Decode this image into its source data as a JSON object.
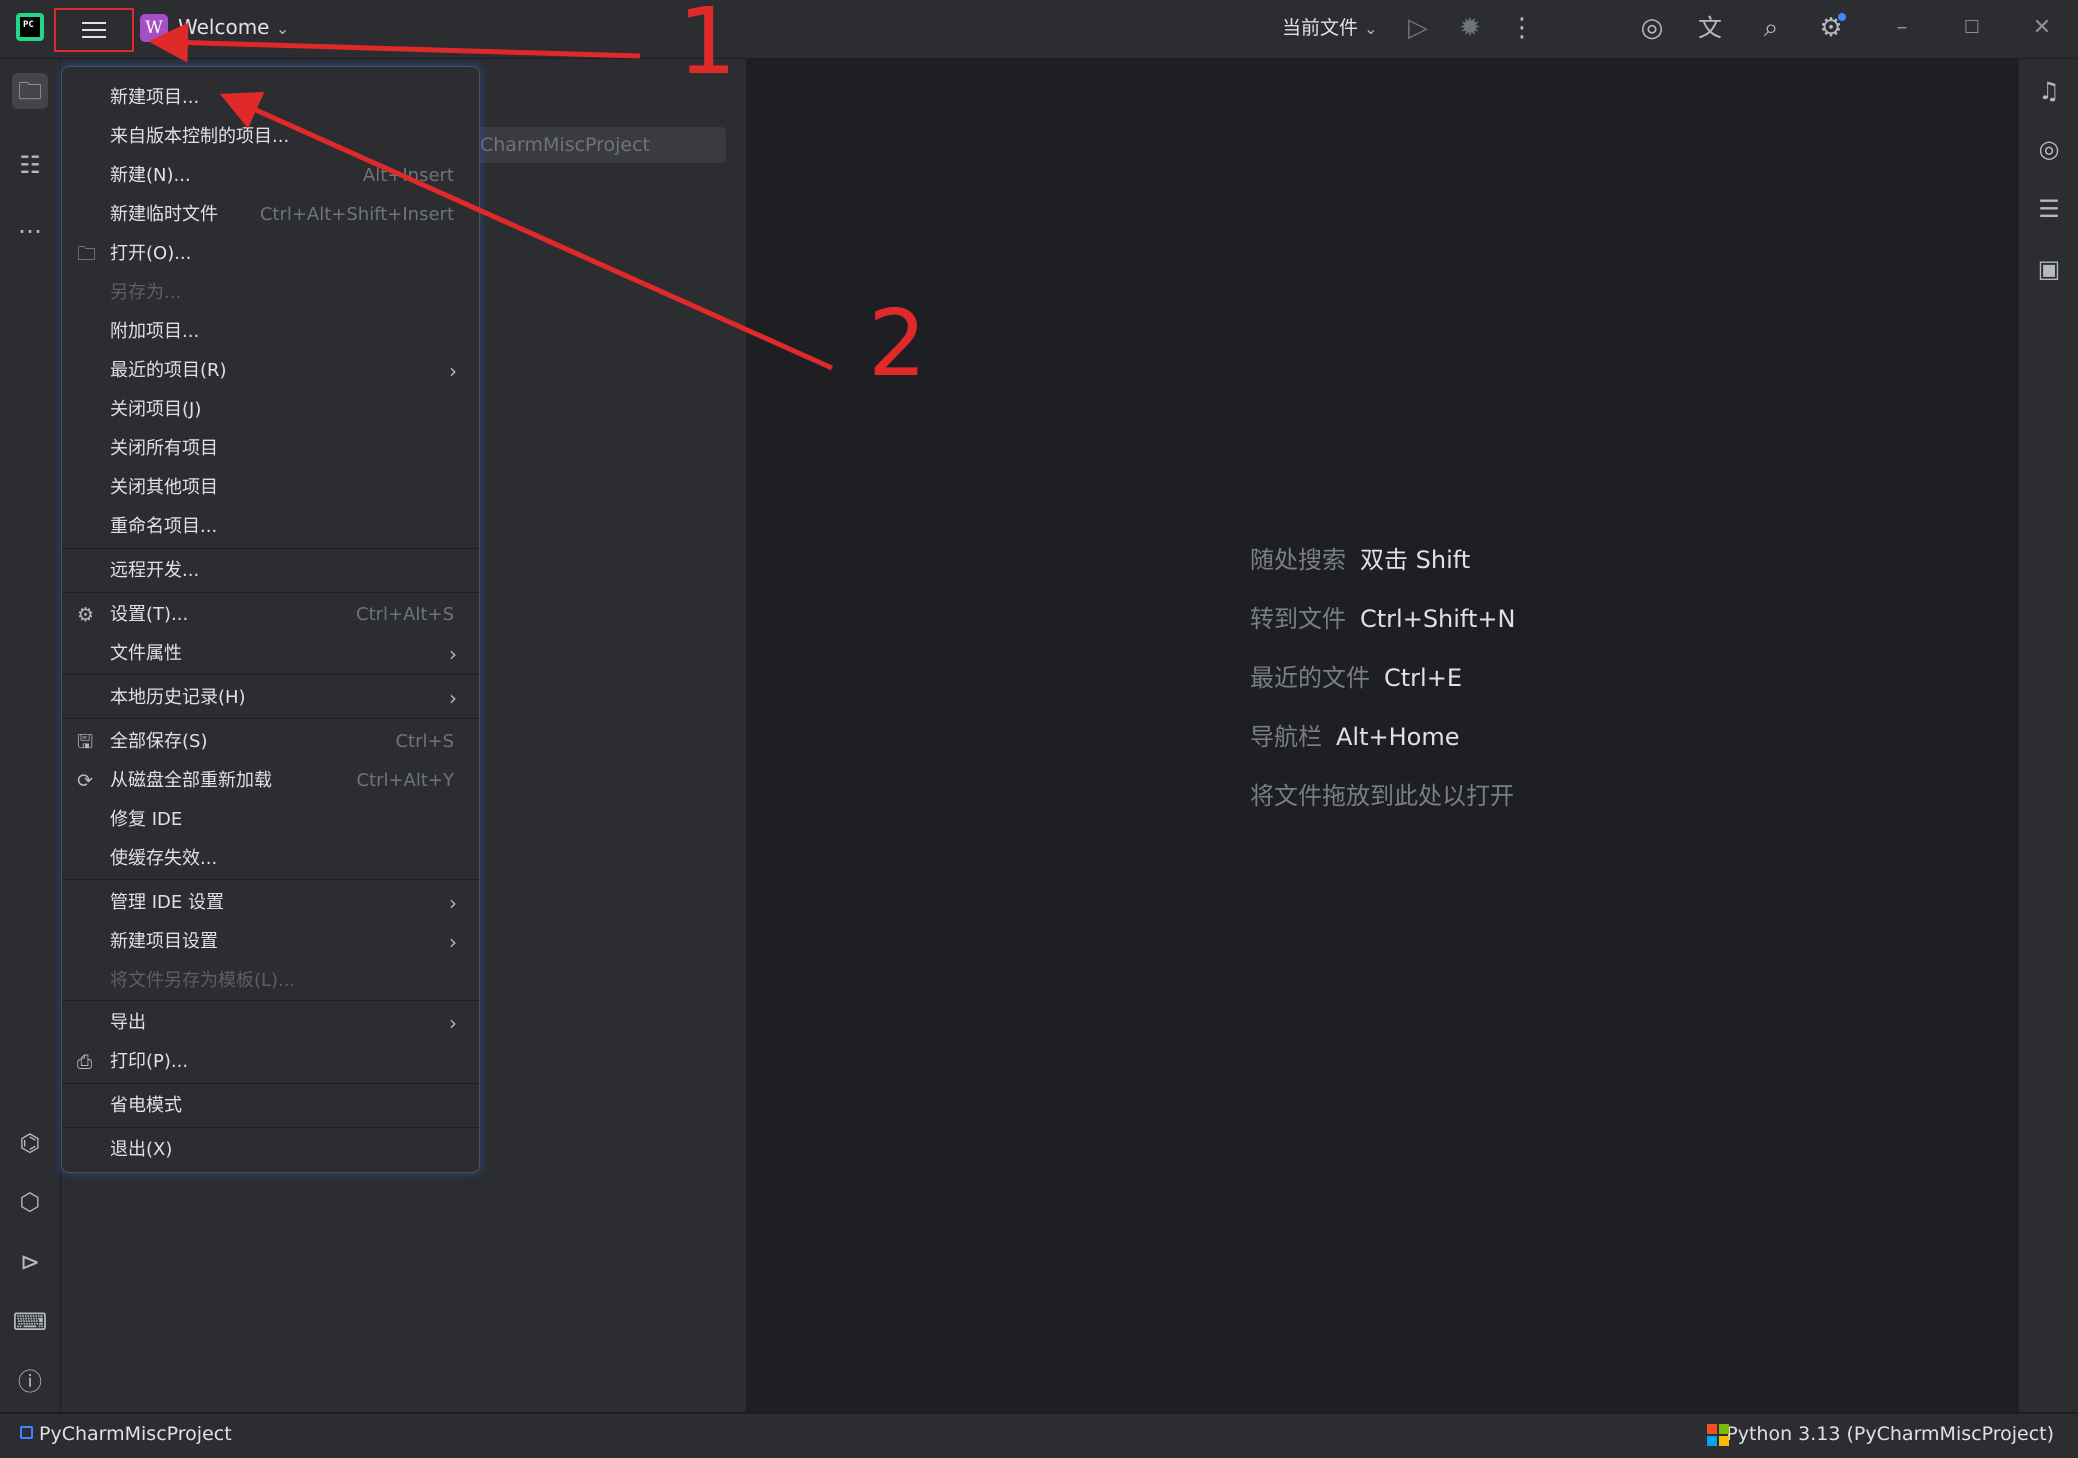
{
  "titlebar": {
    "logo_text": "PC",
    "project_badge": "W",
    "project_name": "Welcome",
    "project_chevron": "⌄",
    "run_config": "当前文件",
    "run_config_chevron": "⌄"
  },
  "annotations": {
    "one": "1",
    "two": "2"
  },
  "panel": {
    "field_text": "CharmMiscProject"
  },
  "menu": {
    "items": [
      {
        "label": "新建项目...",
        "shortcut": ""
      },
      {
        "label": "来自版本控制的项目...",
        "shortcut": ""
      },
      {
        "label": "新建(N)...",
        "shortcut": "Alt+Insert"
      },
      {
        "label": "新建临时文件",
        "shortcut": "Ctrl+Alt+Shift+Insert"
      },
      {
        "label": "打开(O)...",
        "shortcut": ""
      },
      {
        "label": "另存为...",
        "shortcut": ""
      },
      {
        "label": "附加项目...",
        "shortcut": ""
      },
      {
        "label": "最近的项目(R)",
        "shortcut": ""
      },
      {
        "label": "关闭项目(J)",
        "shortcut": ""
      },
      {
        "label": "关闭所有项目",
        "shortcut": ""
      },
      {
        "label": "关闭其他项目",
        "shortcut": ""
      },
      {
        "label": "重命名项目...",
        "shortcut": ""
      },
      {
        "label": "远程开发...",
        "shortcut": ""
      },
      {
        "label": "设置(T)...",
        "shortcut": "Ctrl+Alt+S"
      },
      {
        "label": "文件属性",
        "shortcut": ""
      },
      {
        "label": "本地历史记录(H)",
        "shortcut": ""
      },
      {
        "label": "全部保存(S)",
        "shortcut": "Ctrl+S"
      },
      {
        "label": "从磁盘全部重新加载",
        "shortcut": "Ctrl+Alt+Y"
      },
      {
        "label": "修复 IDE",
        "shortcut": ""
      },
      {
        "label": "使缓存失效...",
        "shortcut": ""
      },
      {
        "label": "管理 IDE 设置",
        "shortcut": ""
      },
      {
        "label": "新建项目设置",
        "shortcut": ""
      },
      {
        "label": "将文件另存为模板(L)...",
        "shortcut": ""
      },
      {
        "label": "导出",
        "shortcut": ""
      },
      {
        "label": "打印(P)...",
        "shortcut": ""
      },
      {
        "label": "省电模式",
        "shortcut": ""
      },
      {
        "label": "退出(X)",
        "shortcut": ""
      }
    ]
  },
  "editor_hints": [
    {
      "key": "随处搜索",
      "value": "双击 Shift"
    },
    {
      "key": "转到文件",
      "value": "Ctrl+Shift+N"
    },
    {
      "key": "最近的文件",
      "value": "Ctrl+E"
    },
    {
      "key": "导航栏",
      "value": "Alt+Home"
    },
    {
      "key": "将文件拖放到此处以打开",
      "value": ""
    }
  ],
  "status": {
    "project": "PyCharmMiscProject",
    "interpreter": "Python 3.13 (PyCharmMiscProject)"
  },
  "icons": {
    "folder": "folder-icon",
    "gear": "gear-icon",
    "save": "save-icon",
    "reload": "reload-icon",
    "print": "print-icon",
    "chevron": "chevron-right-icon"
  },
  "colors": {
    "annotation": "#e02a2a",
    "background": "#1e1f22",
    "panel": "#2b2d30",
    "project_badge": "#a54fc7",
    "accent": "#3e86ff"
  }
}
